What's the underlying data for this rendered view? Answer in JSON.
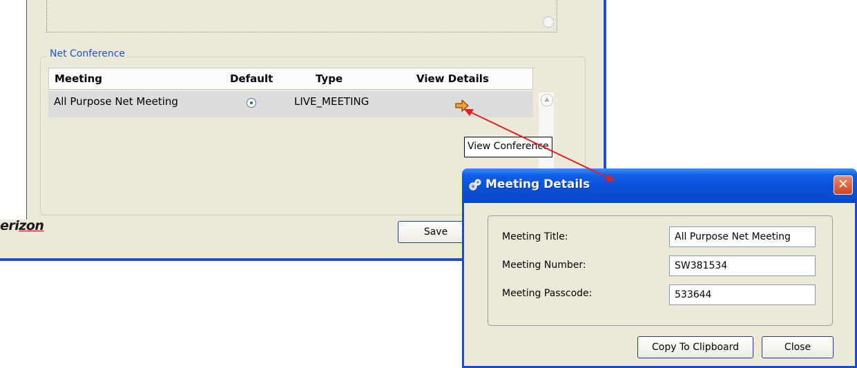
{
  "net_conference": {
    "legend": "Net Conference",
    "columns": [
      "Meeting",
      "Default",
      "Type",
      "View Details"
    ],
    "rows": [
      {
        "meeting": "All Purpose Net Meeting",
        "type": "LIVE_MEETING",
        "view_icon": "arrow-right-icon"
      }
    ]
  },
  "tooltip": "View Conference",
  "brand": {
    "prefix": "eri",
    "underlined": "zon"
  },
  "save_label": "Save",
  "dialog": {
    "title": "Meeting Details",
    "fields": [
      {
        "label": "Meeting Title:",
        "value": "All Purpose Net Meeting"
      },
      {
        "label": "Meeting Number:",
        "value": "SW381534"
      },
      {
        "label": "Meeting Passcode:",
        "value": "533644"
      }
    ],
    "copy_label": "Copy To Clipboard",
    "close_label": "Close"
  },
  "colors": {
    "accent": "#0a4fd6",
    "legend": "#1f55c6",
    "connector": "#e0201b"
  }
}
